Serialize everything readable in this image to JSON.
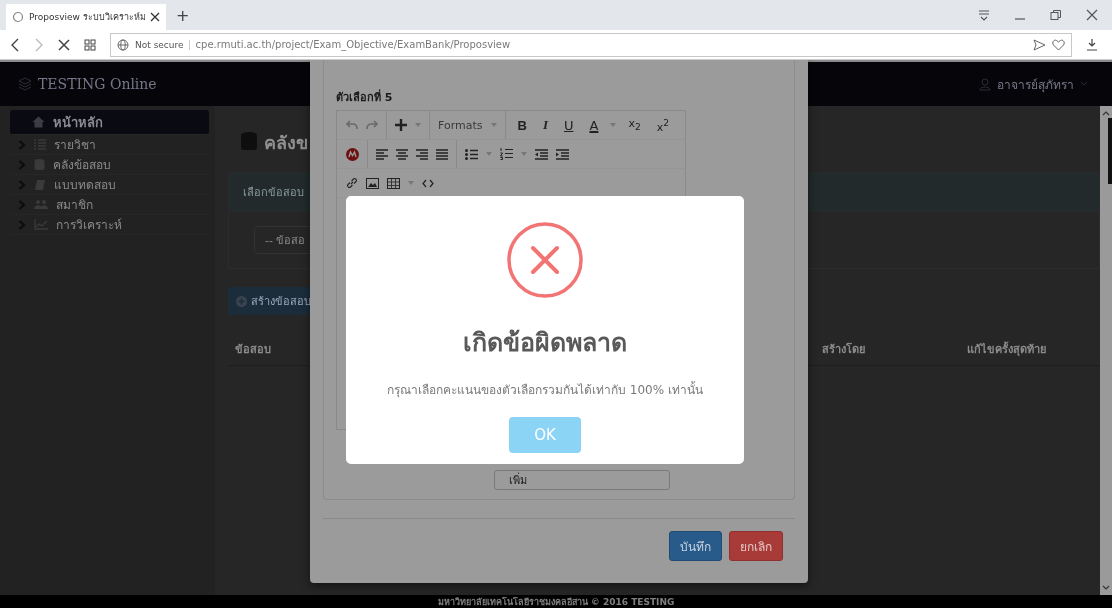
{
  "browser": {
    "tab_title": "Proposview ระบบวิเคราะห์ม",
    "new_tab": "+",
    "security": "Not secure",
    "url": "cpe.rmuti.ac.th/project/Exam_Objective/ExamBank/Proposview"
  },
  "navbar": {
    "brand": "TESTING Online",
    "user": "อาจารย์สุภัทรา"
  },
  "sidebar": {
    "items": [
      {
        "label": "หน้าหลัก",
        "selected": true
      },
      {
        "label": "รายวิชา",
        "selected": false
      },
      {
        "label": "คลังข้อสอบ",
        "selected": false
      },
      {
        "label": "แบบทดสอบ",
        "selected": false
      },
      {
        "label": "สมาชิก",
        "selected": false
      },
      {
        "label": "การวิเคราะห์",
        "selected": false
      }
    ]
  },
  "page": {
    "title": "คลังข",
    "info": "เลือกข้อสอบ",
    "select": "-- ข้อสอ",
    "create_button": "สร้างข้อสอบ",
    "table_columns": [
      "ข้อสอบ",
      "สร้างโดย",
      "แก้ไขครั้งสุดท้าย"
    ]
  },
  "footer": "มหาวิทยาลัยเทคโนโลยีราชมงคลอีสาน © 2016 TESTING",
  "modal": {
    "field_label": "ตัวเลือกที่ 5",
    "editor": {
      "formats": "Formats",
      "glyphs": [
        "B",
        "I",
        "U",
        "A"
      ],
      "subscript": "x$_{2}$",
      "superscript": "x$^{2}$"
    },
    "add_button": "เพิ่ม",
    "buttons": [
      {
        "label": "บันทึก",
        "kind": "primary"
      },
      {
        "label": "ยกเลิก",
        "kind": "danger"
      }
    ]
  },
  "alert": {
    "title": "เกิดข้อผิดพลาด",
    "message": "กรุณาเลือกคะแนนของตัวเลือกรวมกันได้เท่ากับ 100% เท่านั้น",
    "confirm": "OK"
  }
}
